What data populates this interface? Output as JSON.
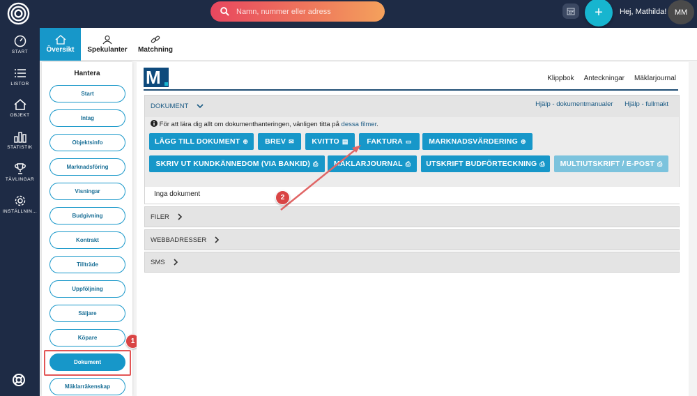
{
  "topbar": {
    "search_placeholder": "Namn, nummer eller adress",
    "greeting": "Hej, Mathilda!",
    "avatar_initials": "MM",
    "plus_label": "+"
  },
  "rail": {
    "items": [
      {
        "label": "START",
        "icon": "gauge-icon"
      },
      {
        "label": "LISTOR",
        "icon": "list-icon"
      },
      {
        "label": "OBJEKT",
        "icon": "home-icon"
      },
      {
        "label": "STATISTIK",
        "icon": "bar-chart-icon"
      },
      {
        "label": "TÄVLINGAR",
        "icon": "trophy-icon"
      },
      {
        "label": "INSTÄLLNIN...",
        "icon": "gear-icon"
      }
    ]
  },
  "subnav": {
    "tabs": [
      {
        "label": "Översikt",
        "icon": "home-icon",
        "active": true
      },
      {
        "label": "Spekulanter",
        "icon": "users-icon",
        "active": false
      },
      {
        "label": "Matchning",
        "icon": "link-icon",
        "active": false
      }
    ]
  },
  "hantera": {
    "title": "Hantera",
    "buttons": [
      "Start",
      "Intag",
      "Objektsinfo",
      "Marknadsföring",
      "Visningar",
      "Budgivning",
      "Kontrakt",
      "Tillträde",
      "Uppföljning",
      "Säljare",
      "Köpare",
      "Dokument",
      "Mäklarräkenskap"
    ],
    "active": "Dokument"
  },
  "badges": {
    "one": "1",
    "two": "2"
  },
  "main": {
    "logo_letter": "M",
    "top_links": [
      "Klippbok",
      "Anteckningar",
      "Mäklarjournal"
    ],
    "dokument": {
      "title": "DOKUMENT",
      "help_links": [
        "Hjälp - dokumentmanualer",
        "Hjälp - fullmakt"
      ],
      "info_text": "För att lära dig allt om dokumenthanteringen, vänligen titta på",
      "info_link": "dessa filmer",
      "info_end": ".",
      "buttons": [
        {
          "label": "LÄGG TILL DOKUMENT",
          "icon": "plus-circle-icon"
        },
        {
          "label": "BREV",
          "icon": "envelope-icon"
        },
        {
          "label": "KVITTO",
          "icon": "file-icon"
        },
        {
          "label": "FAKTURA",
          "icon": "card-icon"
        },
        {
          "label": "MARKNADSVÄRDERING",
          "icon": "plus-circle-icon"
        },
        {
          "label": "SKRIV UT KUNDKÄNNEDOM (VIA BANKID)",
          "icon": "print-icon"
        },
        {
          "label": "MÄKLARJOURNAL",
          "icon": "print-icon"
        },
        {
          "label": "UTSKRIFT BUDFÖRTECKNING",
          "icon": "print-icon"
        },
        {
          "label": "MULTIUTSKRIFT / E-POST",
          "icon": "print-icon"
        }
      ],
      "empty_text": "Inga dokument"
    },
    "sections": [
      "FILER",
      "WEBBADRESSER",
      "SMS"
    ]
  },
  "colors": {
    "nav_bg": "#1e2b45",
    "accent": "#1797c9",
    "badge_red": "#d94444"
  }
}
